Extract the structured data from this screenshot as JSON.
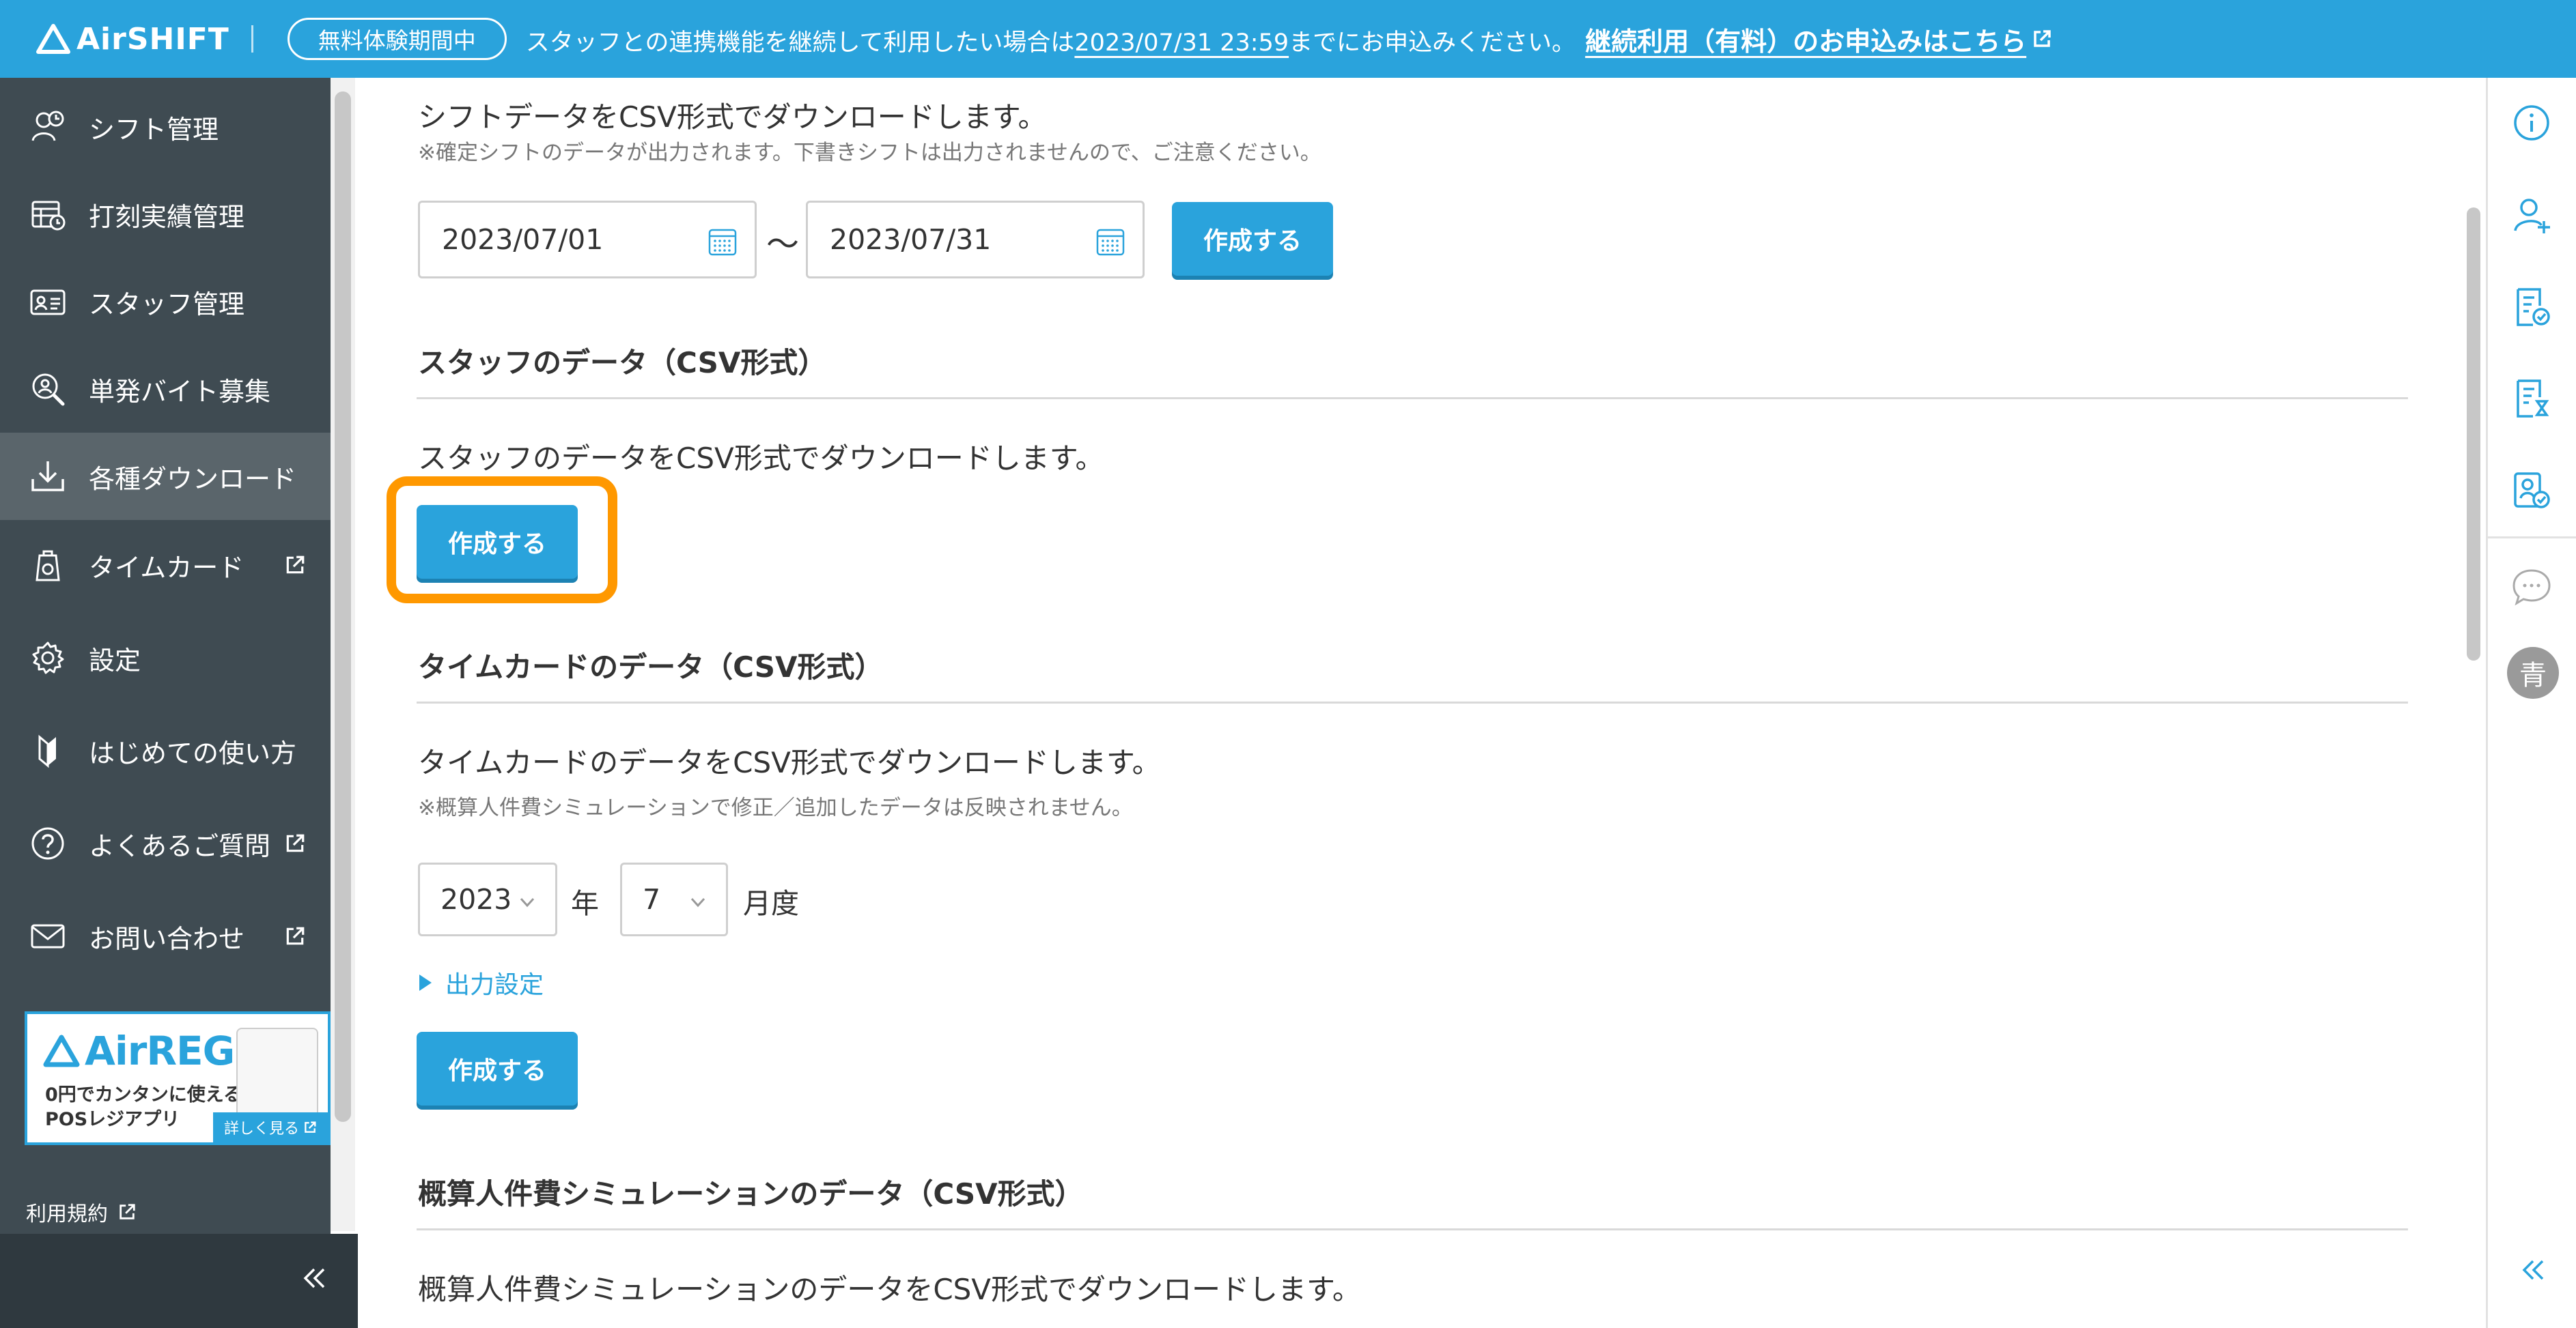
{
  "banner": {
    "logo": "AirSHIFT",
    "trial_badge": "無料体験期間中",
    "message_before": "スタッフとの連携機能を継続して利用したい場合は",
    "deadline": "2023/07/31 23:59",
    "message_after": "までにお申込みください。",
    "apply_link": "継続利用（有料）のお申込みはこちら"
  },
  "sidebar": {
    "items": [
      {
        "label": "シフト管理",
        "icon": "shift-calendar-icon"
      },
      {
        "label": "打刻実績管理",
        "icon": "timestamp-record-icon"
      },
      {
        "label": "スタッフ管理",
        "icon": "staff-card-icon"
      },
      {
        "label": "単発バイト募集",
        "icon": "recruit-search-icon"
      },
      {
        "label": "各種ダウンロード",
        "icon": "download-icon",
        "active": true
      },
      {
        "label": "タイムカード",
        "icon": "timecard-icon",
        "external": true
      },
      {
        "label": "設定",
        "icon": "gear-icon"
      },
      {
        "label": "はじめての使い方",
        "icon": "beginner-mark-icon"
      },
      {
        "label": "よくあるご質問",
        "icon": "question-icon",
        "external": true
      },
      {
        "label": "お問い合わせ",
        "icon": "mail-icon",
        "external": true
      }
    ],
    "promo": {
      "name": "AirREGI",
      "line1": "0円でカンタンに使える",
      "line2": "POSレジアプリ",
      "more": "詳しく見る"
    },
    "terms": "利用規約"
  },
  "shift_section": {
    "desc": "シフトデータをCSV形式でダウンロードします。",
    "note": "※確定シフトのデータが出力されます。下書きシフトは出力されませんので、ご注意ください。",
    "start_date": "2023/07/01",
    "separator": "〜",
    "end_date": "2023/07/31",
    "create_label": "作成する"
  },
  "staff_section": {
    "title": "スタッフのデータ（CSV形式）",
    "desc": "スタッフのデータをCSV形式でダウンロードします。",
    "create_label": "作成する"
  },
  "timecard_section": {
    "title": "タイムカードのデータ（CSV形式）",
    "desc": "タイムカードのデータをCSV形式でダウンロードします。",
    "note": "※概算人件費シミュレーションで修正／追加したデータは反映されません。",
    "year_value": "2023",
    "year_unit": "年",
    "month_value": "7",
    "month_unit": "月度",
    "output_settings": "出力設定",
    "create_label": "作成する"
  },
  "simulation_section": {
    "title": "概算人件費シミュレーションのデータ（CSV形式）",
    "desc": "概算人件費シミュレーションのデータをCSV形式でダウンロードします。"
  },
  "rail": {
    "avatar_initial": "青"
  },
  "colors": {
    "accent": "#2aa3dc",
    "sidebar_bg": "#3f4b52",
    "highlight": "#ff9800"
  }
}
